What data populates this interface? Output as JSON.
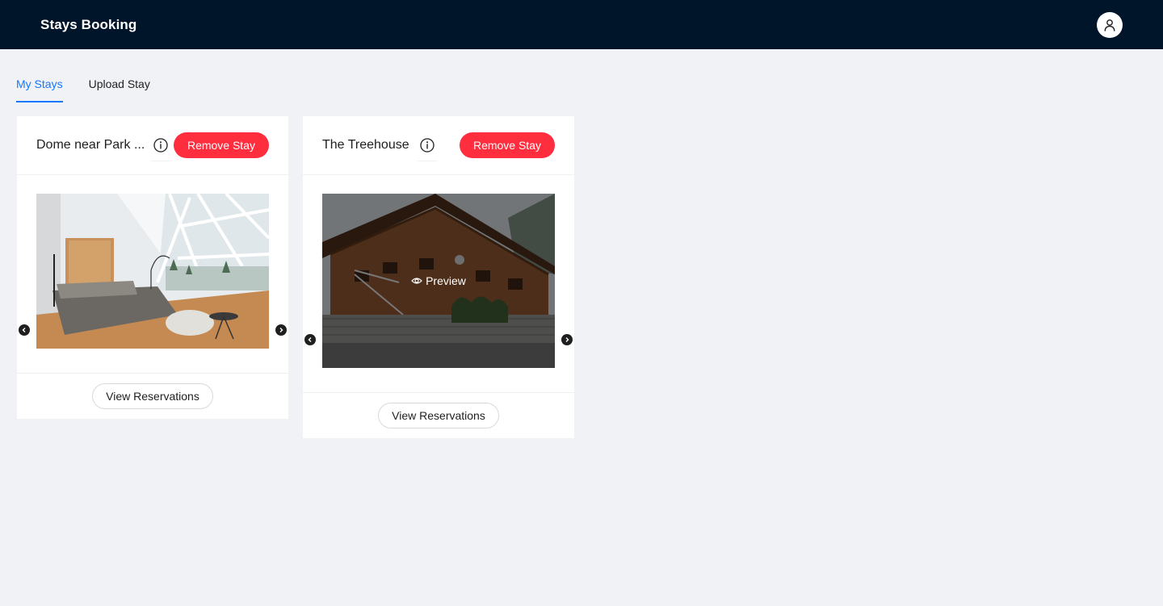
{
  "header": {
    "title": "Stays Booking",
    "user_icon": "user-icon"
  },
  "tabs": [
    {
      "label": "My Stays",
      "active": true
    },
    {
      "label": "Upload Stay",
      "active": false
    }
  ],
  "stays": [
    {
      "title": "Dome near Park ...",
      "info_icon": "info-icon",
      "remove_label": "Remove Stay",
      "photo": "dome-bedroom-photo",
      "view_label": "View Reservations"
    },
    {
      "title": "The Treehouse",
      "info_icon": "info-icon",
      "remove_label": "Remove Stay",
      "photo": "wooden-chalet-photo",
      "preview_label": "Preview",
      "view_label": "View Reservations"
    }
  ],
  "colors": {
    "header_bg": "#001529",
    "page_bg": "#f0f2f5",
    "accent": "#1677ff",
    "remove_button": "#ff2e3f"
  }
}
